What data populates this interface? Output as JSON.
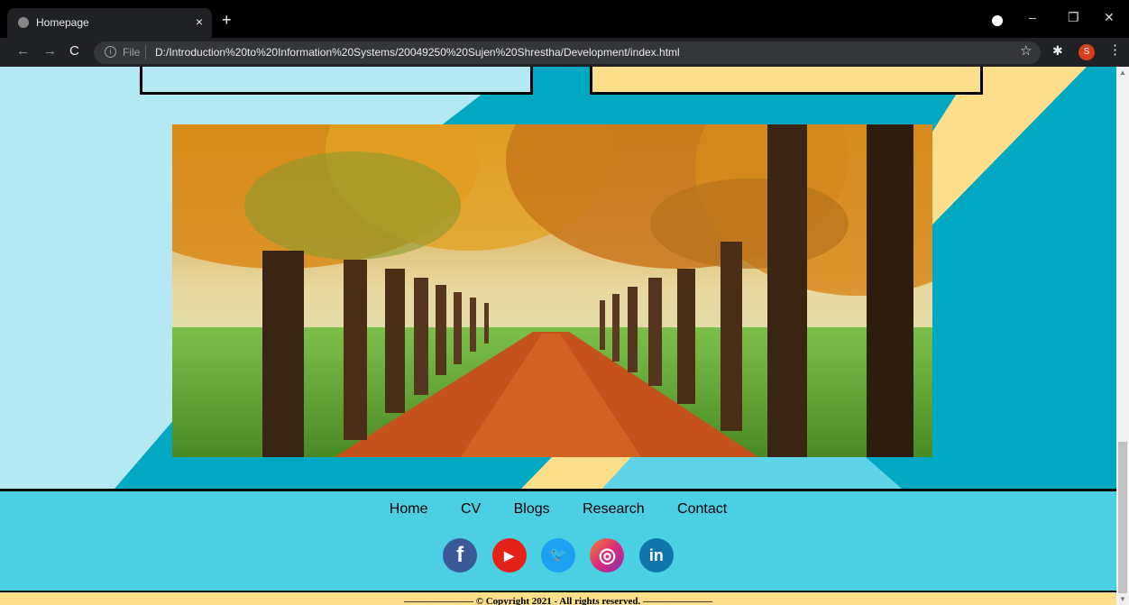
{
  "browser": {
    "tab_title": "Homepage",
    "tab_close": "×",
    "new_tab": "+",
    "file_label": "File",
    "url": "D:/Introduction%20to%20Information%20Systems/20049250%20Sujen%20Shrestha/Development/index.html",
    "profile_initial": "S",
    "window_controls": [
      "–",
      "❐",
      "✕"
    ],
    "icons": [
      "back-icon",
      "forward-icon",
      "reload-icon",
      "info-icon",
      "star-icon",
      "extensions-icon",
      "menu-icon"
    ]
  },
  "hero_image": {
    "description_icon": "autumn-tree-avenue-photo"
  },
  "footer": {
    "nav": [
      "Home",
      "CV",
      "Blogs",
      "Research",
      "Contact"
    ],
    "social": [
      {
        "name": "facebook",
        "glyph": "f",
        "color": "#3b5998"
      },
      {
        "name": "youtube",
        "glyph": "▶",
        "color": "#e62117"
      },
      {
        "name": "twitter",
        "glyph": "🐦",
        "color": "#1da1f2"
      },
      {
        "name": "instagram",
        "glyph": "◎",
        "color": "#c13584"
      },
      {
        "name": "linkedin",
        "glyph": "in",
        "color": "#0e76a8"
      }
    ],
    "copyright": "——————— © Copyright 2021 - All rights reserved. ———————"
  },
  "colors": {
    "background_teal": "#00a8c2",
    "light_blue": "#b4e8f2",
    "yellow": "#fdde8a",
    "footer_blue": "#4bcfe3"
  }
}
